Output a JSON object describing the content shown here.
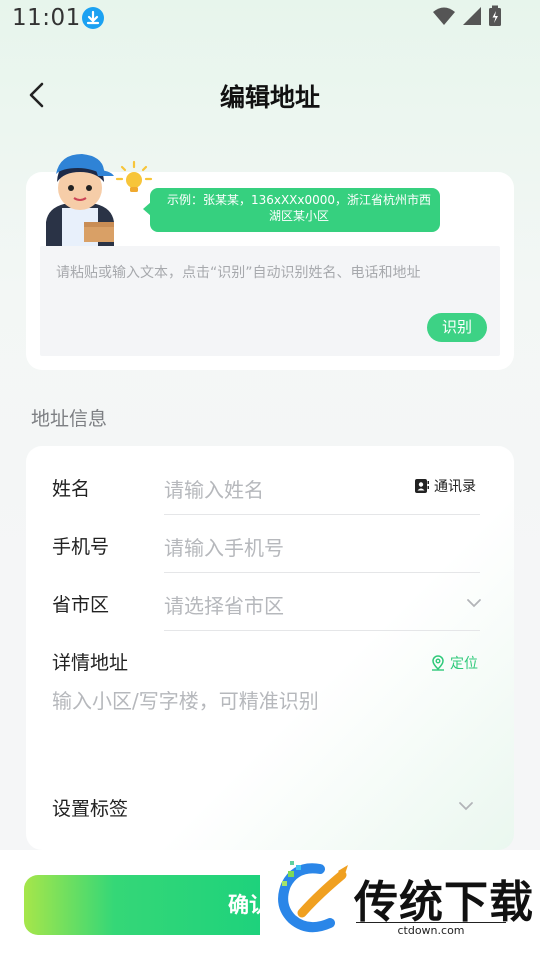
{
  "status_bar": {
    "time": "11:01"
  },
  "header": {
    "title": "编辑地址"
  },
  "paste": {
    "tip": "示例：张某某，136xXXx0000，浙江省杭州市西湖区某小区",
    "placeholder": "请粘贴或输入文本，点击“识别”自动识别姓名、电话和地址",
    "recognize_label": "识别"
  },
  "section": {
    "title": "地址信息"
  },
  "form": {
    "name": {
      "label": "姓名",
      "placeholder": "请输入姓名",
      "contacts_label": "通讯录"
    },
    "phone": {
      "label": "手机号",
      "placeholder": "请输入手机号"
    },
    "region": {
      "label": "省市区",
      "placeholder": "请选择省市区"
    },
    "detail": {
      "label": "详情地址",
      "placeholder": "输入小区/写字楼，可精准识别",
      "locate_label": "定位"
    },
    "tag": {
      "label": "设置标签"
    }
  },
  "footer": {
    "confirm_label": "确认"
  },
  "watermark": {
    "brand": "传统下载",
    "site": "ctdown.com"
  },
  "colors": {
    "accent": "#36d07f",
    "background": "#f5f6f7"
  }
}
